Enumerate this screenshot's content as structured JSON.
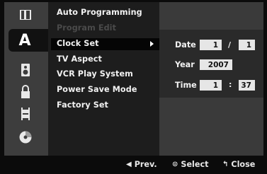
{
  "menu": {
    "items": [
      {
        "label": "Auto Programming",
        "disabled": false
      },
      {
        "label": "Program Edit",
        "disabled": true
      },
      {
        "label": "Clock Set",
        "disabled": false,
        "selected": true
      },
      {
        "label": "TV Aspect",
        "disabled": false
      },
      {
        "label": "VCR Play System",
        "disabled": false
      },
      {
        "label": "Power Save Mode",
        "disabled": false
      },
      {
        "label": "Factory Set",
        "disabled": false
      }
    ]
  },
  "icons": [
    "film-strip-icon",
    "language-a-icon",
    "speaker-icon",
    "lock-icon",
    "film-icon",
    "disc-icon"
  ],
  "clock": {
    "date_label": "Date",
    "date_month": "1",
    "date_sep": "/",
    "date_day": "1",
    "year_label": "Year",
    "year_value": "2007",
    "time_label": "Time",
    "time_hour": "1",
    "time_sep": ":",
    "time_minute": "37"
  },
  "footer": {
    "prev_label": "Prev.",
    "select_label": "Select",
    "close_label": "Close"
  }
}
